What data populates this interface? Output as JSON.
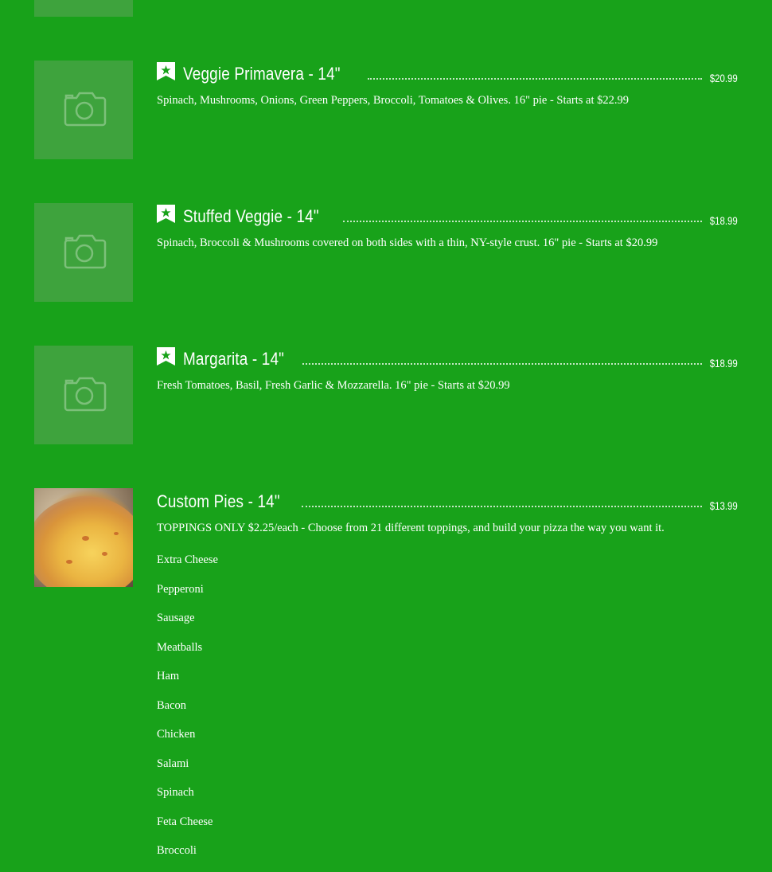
{
  "items": [
    {
      "title": "Veggie Primavera - 14\"",
      "price": "$20.99",
      "description": "Spinach, Mushrooms, Onions, Green Peppers, Broccoli, Tomatoes & Olives. 16\" pie - Starts at $22.99"
    },
    {
      "title": "Stuffed Veggie - 14\"",
      "price": "$18.99",
      "description": "Spinach, Broccoli & Mushrooms covered on both sides with a thin, NY-style crust. 16\" pie - Starts at $20.99"
    },
    {
      "title": "Margarita - 14\"",
      "price": "$18.99",
      "description": "Fresh Tomatoes, Basil, Fresh Garlic & Mozzarella. 16\" pie - Starts at $20.99"
    },
    {
      "title": "Custom Pies - 14\"",
      "price": "$13.99",
      "description": "TOPPINGS ONLY $2.25/each - Choose from 21 different toppings, and build your pizza the way you want it.",
      "toppings": [
        "Extra Cheese",
        "Pepperoni",
        "Sausage",
        "Meatballs",
        "Ham",
        "Bacon",
        "Chicken",
        "Salami",
        "Spinach",
        "Feta Cheese",
        "Broccoli"
      ]
    }
  ],
  "icons": {
    "placeholder": "camera-placeholder-icon",
    "badge": "star-badge-icon"
  },
  "colors": {
    "background": "#18a21a",
    "thumb_placeholder": "#3ea33d",
    "text": "#ffffff"
  }
}
